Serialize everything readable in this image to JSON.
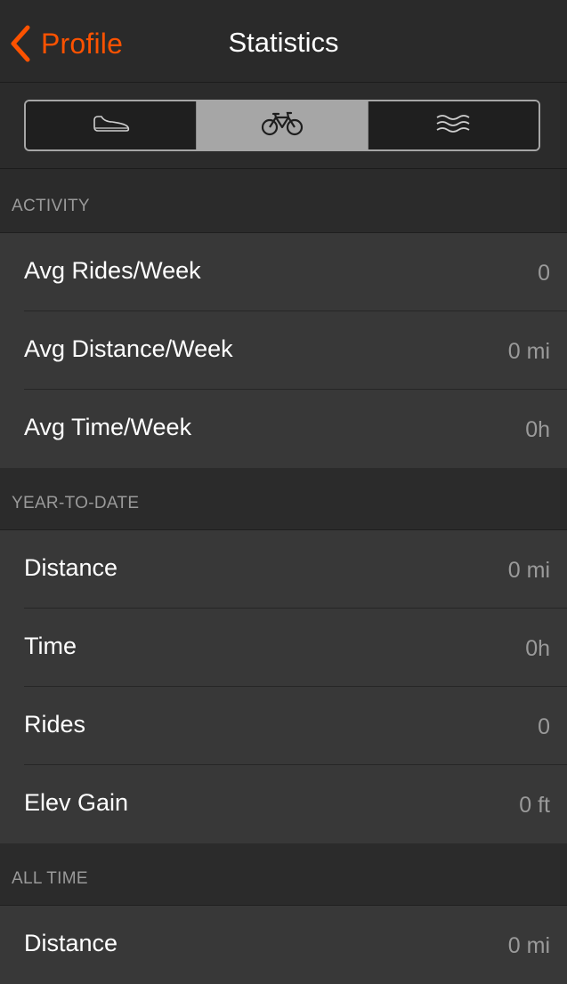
{
  "navbar": {
    "back_label": "Profile",
    "title": "Statistics",
    "accent_color": "#fc5200"
  },
  "segments": [
    {
      "icon": "shoe-icon",
      "name": "run"
    },
    {
      "icon": "bicycle-icon",
      "name": "ride",
      "selected": true
    },
    {
      "icon": "water-waves-icon",
      "name": "swim"
    }
  ],
  "sections": [
    {
      "title": "ACTIVITY",
      "rows": [
        {
          "label": "Avg Rides/Week",
          "value": "0"
        },
        {
          "label": "Avg Distance/Week",
          "value": "0 mi"
        },
        {
          "label": "Avg Time/Week",
          "value": "0h"
        }
      ]
    },
    {
      "title": "YEAR-TO-DATE",
      "rows": [
        {
          "label": "Distance",
          "value": "0 mi"
        },
        {
          "label": "Time",
          "value": "0h"
        },
        {
          "label": "Rides",
          "value": "0"
        },
        {
          "label": "Elev Gain",
          "value": "0 ft"
        }
      ]
    },
    {
      "title": "ALL TIME",
      "rows": [
        {
          "label": "Distance",
          "value": "0 mi"
        }
      ]
    }
  ]
}
